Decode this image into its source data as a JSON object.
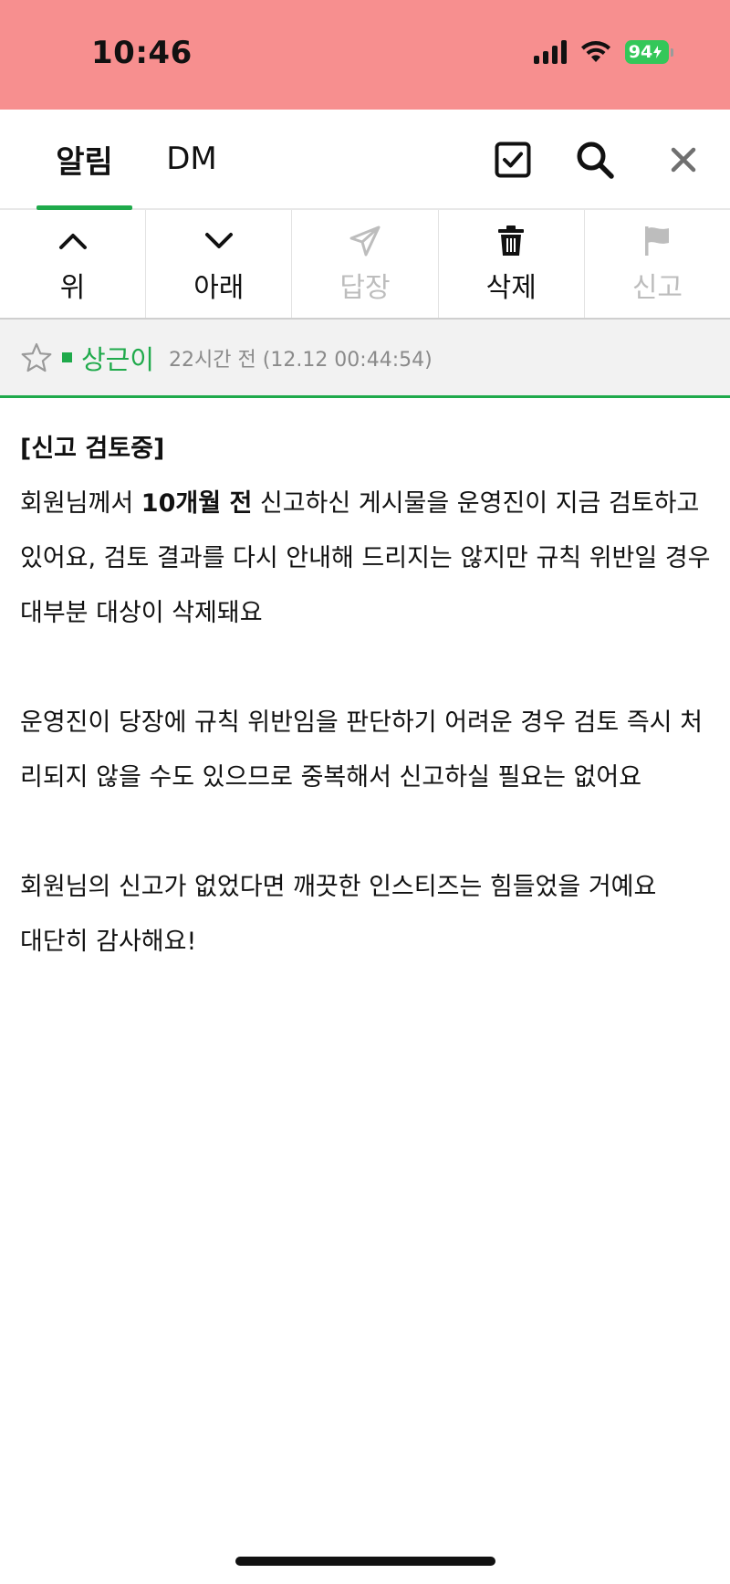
{
  "status": {
    "time": "10:46",
    "battery": "94"
  },
  "tabs": [
    {
      "label": "알림",
      "active": true
    },
    {
      "label": "DM",
      "active": false
    }
  ],
  "header_icons": [
    "checkbox-icon",
    "search-icon",
    "close-icon"
  ],
  "toolbar": [
    {
      "label": "위",
      "icon": "chevron-up-icon",
      "enabled": true
    },
    {
      "label": "아래",
      "icon": "chevron-down-icon",
      "enabled": true
    },
    {
      "label": "답장",
      "icon": "send-icon",
      "enabled": false
    },
    {
      "label": "삭제",
      "icon": "trash-icon",
      "enabled": true
    },
    {
      "label": "신고",
      "icon": "flag-icon",
      "enabled": false
    }
  ],
  "message": {
    "author": "상근이",
    "timestamp": "22시간 전 (12.12 00:44:54)",
    "title": "[신고 검토중]",
    "p1_before": "회원님께서 ",
    "p1_bold": "10개월 전",
    "p1_after": " 신고하신 게시물을 운영진이 지금 검토하고 있어요, 검토 결과를 다시 안내해 드리지는 않지만 규칙 위반일 경우 대부분 대상이 삭제돼요",
    "p2": "운영진이 당장에 규칙 위반임을 판단하기 어려운 경우 검토 즉시 처리되지 않을 수도 있으므로 중복해서 신고하실 필요는 없어요",
    "p3": "회원님의 신고가 없었다면 깨끗한 인스티즈는 힘들었을 거예요",
    "p4": "대단히 감사해요!"
  },
  "colors": {
    "status_bar": "#f78f8f",
    "accent": "#1faa4b",
    "battery": "#34c759",
    "disabled": "#bdbdbd"
  }
}
